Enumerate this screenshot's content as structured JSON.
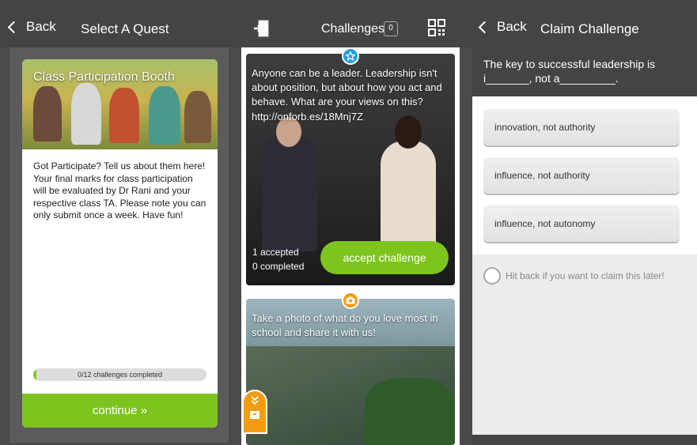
{
  "panel1": {
    "back_label": "Back",
    "title": "Select A Quest",
    "quest": {
      "name": "Class Participation Booth",
      "description": "Got Participate? Tell us about them here! Your final marks for class participation will be evaluated by Dr Rani and your respective class TA. Please note you can only submit once a week. Have fun!",
      "progress_text": "0/12 challenges completed",
      "progress_fraction": 0.02,
      "continue_label": "continue »"
    }
  },
  "panel2": {
    "title": "Challenges",
    "badge_count": "0",
    "challenges": [
      {
        "type_icon": "star-icon",
        "text": "Anyone can be a leader. Leadership isn't about position, but about how you act and behave. What are your views on this? http://onforb.es/18Mnj7Z",
        "accepted": "1 accepted",
        "completed": "0 completed",
        "accept_label": "accept challenge"
      },
      {
        "type_icon": "camera-icon",
        "text": "Take a photo of what do you love most in school and share it with us!"
      }
    ]
  },
  "panel3": {
    "back_label": "Back",
    "title": "Claim Challenge",
    "question": "The key to successful leadership is i_______, not a_________.",
    "answers": [
      "innovation, not authority",
      "influence, not authority",
      "influence, not autonomy"
    ],
    "hint": "Hit back if you want to claim this later!"
  },
  "colors": {
    "accent_green": "#7dc41f",
    "badge_blue": "#2a9ee0",
    "badge_orange": "#f39c12",
    "bar_dark": "#444444"
  }
}
